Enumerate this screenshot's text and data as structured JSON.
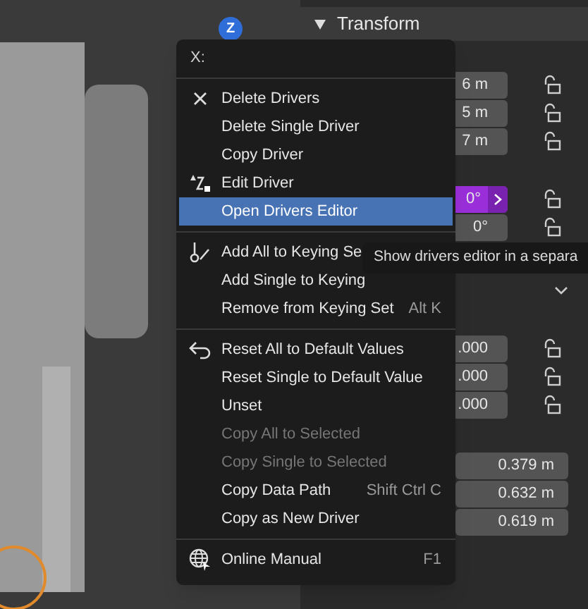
{
  "viewport": {
    "gizmo_axis": "Z"
  },
  "panel": {
    "title": "Transform",
    "groups": [
      {
        "kind": "fields",
        "fields": [
          {
            "value": "6 m",
            "driven": false
          },
          {
            "value": "5 m",
            "driven": false
          },
          {
            "value": "7 m",
            "driven": false
          }
        ]
      },
      {
        "kind": "fields",
        "fields": [
          {
            "value": "0°",
            "driven": true
          },
          {
            "value": "0°",
            "driven": false
          }
        ]
      },
      {
        "kind": "dropdown"
      },
      {
        "kind": "fields",
        "fields": [
          {
            "value": ".000",
            "driven": false
          },
          {
            "value": ".000",
            "driven": false
          },
          {
            "value": ".000",
            "driven": false
          }
        ]
      },
      {
        "kind": "dimensions",
        "fields": [
          {
            "value": "0.379 m",
            "driven": false
          },
          {
            "value": "0.632 m",
            "driven": false
          },
          {
            "value": "0.619 m",
            "driven": false
          }
        ]
      }
    ]
  },
  "menu": {
    "title": "X:",
    "sections": [
      [
        {
          "label": "Delete Drivers",
          "disabled": false,
          "selected": false
        },
        {
          "label": "Delete Single Driver",
          "disabled": false,
          "selected": false
        },
        {
          "label": "Copy Driver",
          "disabled": false,
          "selected": false
        },
        {
          "label": "Edit Driver",
          "disabled": false,
          "selected": false
        },
        {
          "label": "Open Drivers Editor",
          "disabled": false,
          "selected": true
        }
      ],
      [
        {
          "label": "Add All to Keying Se",
          "disabled": false,
          "selected": false
        },
        {
          "label": "Add Single to Keying",
          "disabled": false,
          "selected": false
        },
        {
          "label": "Remove from Keying Set",
          "shortcut": "Alt K",
          "disabled": false,
          "selected": false
        }
      ],
      [
        {
          "label": "Reset All to Default Values",
          "disabled": false,
          "selected": false
        },
        {
          "label": "Reset Single to Default Value",
          "disabled": false,
          "selected": false
        },
        {
          "label": "Unset",
          "disabled": false,
          "selected": false
        },
        {
          "label": "Copy All to Selected",
          "disabled": true,
          "selected": false
        },
        {
          "label": "Copy Single to Selected",
          "disabled": true,
          "selected": false
        },
        {
          "label": "Copy Data Path",
          "shortcut": "Shift Ctrl C",
          "disabled": false,
          "selected": false
        },
        {
          "label": "Copy as New Driver",
          "disabled": false,
          "selected": false
        }
      ],
      [
        {
          "label": "Online Manual",
          "shortcut": "F1",
          "disabled": false,
          "selected": false
        }
      ]
    ]
  },
  "tooltip": {
    "text": "Show drivers editor in a separa"
  }
}
